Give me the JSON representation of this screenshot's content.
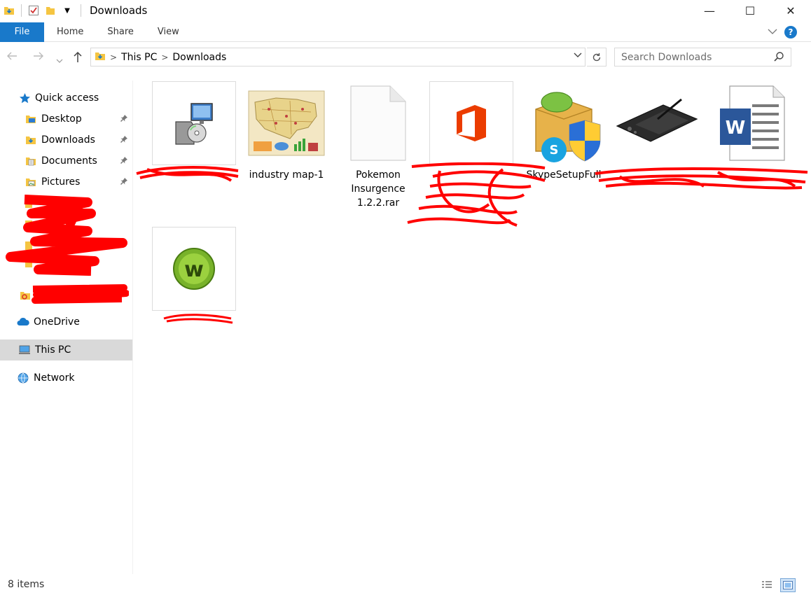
{
  "window": {
    "title": "Downloads",
    "controls": {
      "minimize": "—",
      "maximize": "☐",
      "close": "✕"
    }
  },
  "ribbon": {
    "tabs": [
      "File",
      "Home",
      "Share",
      "View"
    ],
    "help_label": "?"
  },
  "address": {
    "crumbs": [
      "This PC",
      "Downloads"
    ]
  },
  "search": {
    "placeholder": "Search Downloads"
  },
  "sidebar": {
    "quick_access": "Quick access",
    "pinned": [
      "Desktop",
      "Downloads",
      "Documents",
      "Pictures"
    ],
    "onedrive": "OneDrive",
    "this_pc": "This PC",
    "network": "Network"
  },
  "files": [
    {
      "name": "",
      "icon": "installer-icon",
      "redacted": true
    },
    {
      "name": "industry map-1",
      "icon": "map-thumbnail"
    },
    {
      "name": "Pokemon Insurgence 1.2.2.rar",
      "icon": "blank-file-icon"
    },
    {
      "name": "",
      "icon": "office-icon",
      "redacted": true
    },
    {
      "name": "SkypeSetupFull",
      "icon": "skype-setup-icon"
    },
    {
      "name": "",
      "icon": "drawing-tablet-icon",
      "redacted": true
    },
    {
      "name": "",
      "icon": "word-document-icon",
      "redacted": true
    },
    {
      "name": "",
      "icon": "w-app-icon",
      "redacted": true
    }
  ],
  "status": {
    "item_count": "8 items"
  },
  "colors": {
    "accent": "#1979ca",
    "redaction": "#ff0000",
    "office": "#eb3c00",
    "word": "#2b579a"
  }
}
